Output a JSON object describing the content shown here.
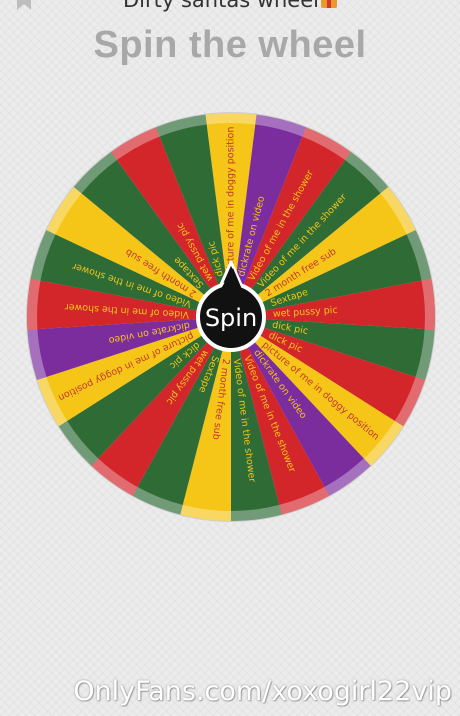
{
  "header": {
    "post_title": "Dirty santas wheel",
    "post_title_icon": "gift-icon",
    "bookmark_icon": "bookmark-icon"
  },
  "page_title": "Spin the wheel",
  "wheel": {
    "spin_label": "Spin",
    "segments": [
      {
        "label": "picture of me in doggy position",
        "color": "#f5c518"
      },
      {
        "label": "dickrate on video",
        "color": "#7b2d9e"
      },
      {
        "label": "Video of me in the shower",
        "color": "#d3262b"
      },
      {
        "label": "Video of me in the shower",
        "color": "#2e6b35"
      },
      {
        "label": "2 month free sub",
        "color": "#f5c518"
      },
      {
        "label": "Sextape",
        "color": "#2e6b35"
      },
      {
        "label": "wet pussy pic",
        "color": "#d3262b"
      },
      {
        "label": "dick pic",
        "color": "#2e6b35"
      },
      {
        "label": "dick pic",
        "color": "#d3262b"
      },
      {
        "label": "picture of me in doggy position",
        "color": "#f5c518"
      },
      {
        "label": "dickrate on video",
        "color": "#7b2d9e"
      },
      {
        "label": "Video of me in the shower",
        "color": "#d3262b"
      },
      {
        "label": "Video of me in the shower",
        "color": "#2e6b35"
      },
      {
        "label": "2 month free sub",
        "color": "#f5c518"
      },
      {
        "label": "Sextape",
        "color": "#2e6b35"
      },
      {
        "label": "wet pussy pic",
        "color": "#d3262b"
      },
      {
        "label": "dick pic",
        "color": "#2e6b35"
      },
      {
        "label": "picture of me in doggy position",
        "color": "#f5c518"
      },
      {
        "label": "dickrate on video",
        "color": "#7b2d9e"
      },
      {
        "label": "Video of me in the shower",
        "color": "#d3262b"
      },
      {
        "label": "Video of me in the shower",
        "color": "#2e6b35"
      },
      {
        "label": "2 month free sub",
        "color": "#f5c518"
      },
      {
        "label": "Sextape",
        "color": "#2e6b35"
      },
      {
        "label": "wet pussy pic",
        "color": "#d3262b"
      },
      {
        "label": "dick pic",
        "color": "#2e6b35"
      }
    ]
  },
  "watermark": "OnlyFans.com/xoxogirl22vip",
  "colors": {
    "yellow": "#f5c518",
    "purple": "#7b2d9e",
    "red": "#d3262b",
    "green": "#2e6b35",
    "label_text": "#c0392b",
    "title_gray": "#a8a8a8",
    "hub": "#111111"
  }
}
